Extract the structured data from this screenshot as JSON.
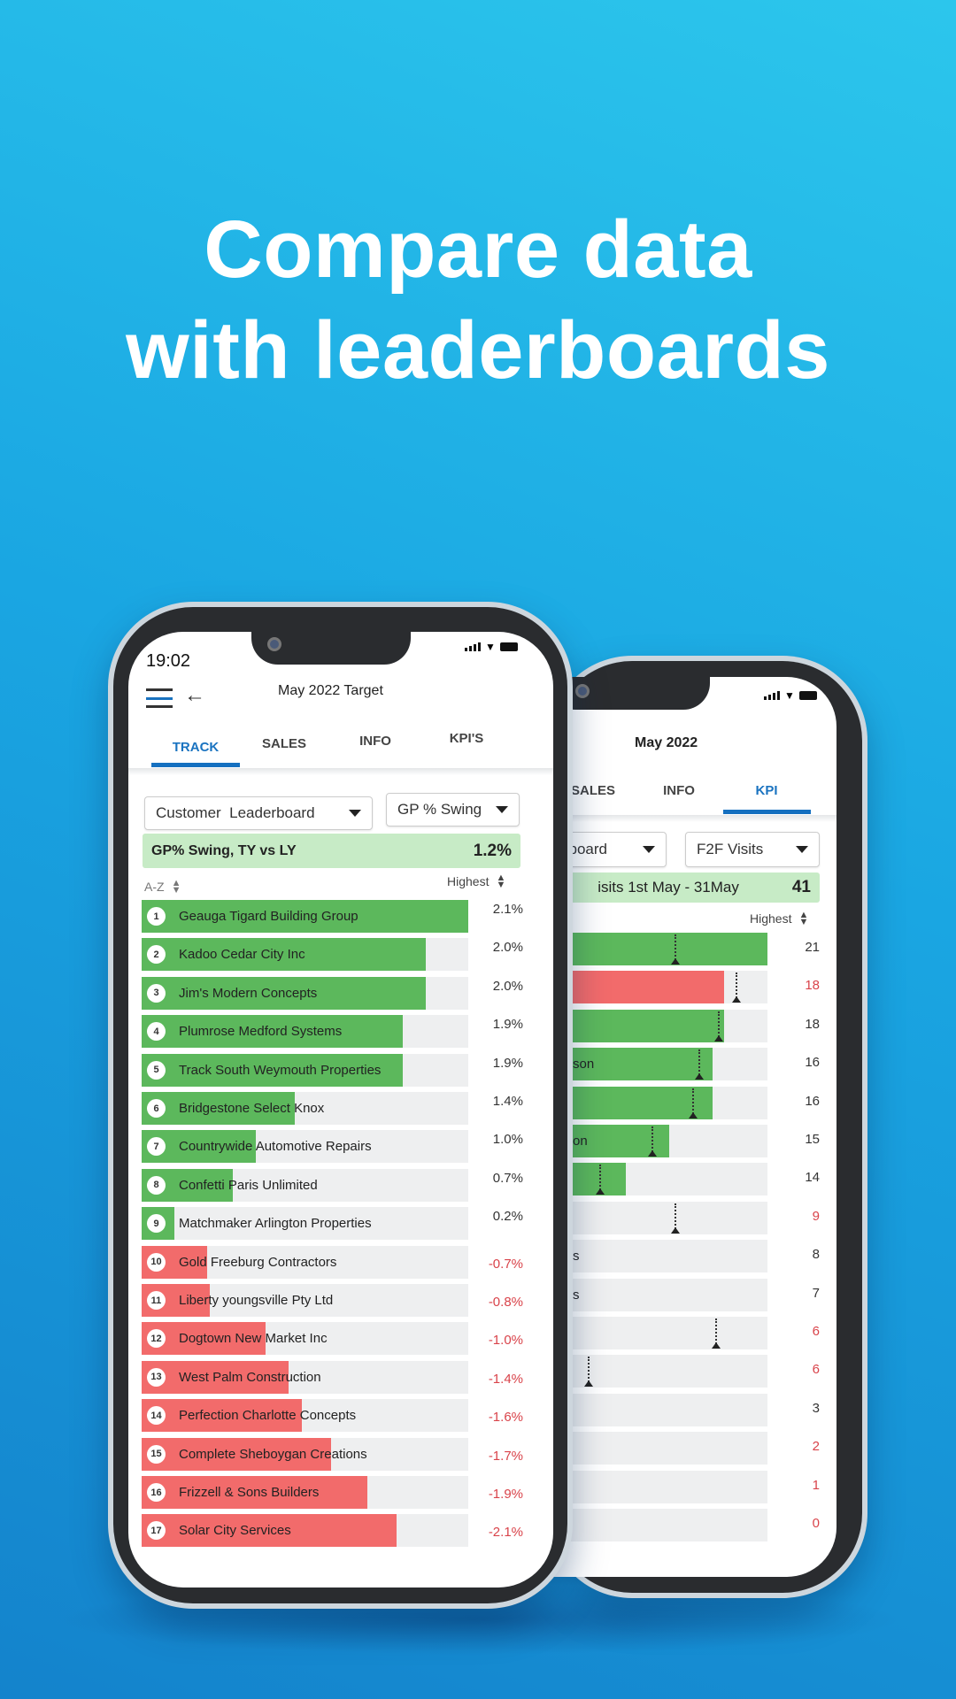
{
  "headline": {
    "line1": "Compare data",
    "line2": "with leaderboards"
  },
  "colors": {
    "positive": "#5cb85c",
    "negative": "#f26b6b",
    "track": "#eeeff0",
    "accent": "#1a73c0",
    "summary_bg": "#c7ebc6",
    "negative_text": "#d9434a"
  },
  "front_phone": {
    "status": {
      "time": "19:02",
      "icons": [
        "signal-icon",
        "wifi-icon",
        "battery-icon"
      ]
    },
    "header": {
      "title": "May 2022 Target",
      "menu_icon": "hamburger-icon",
      "back_icon": "arrow-left-icon"
    },
    "tabs": [
      {
        "label": "TRACK",
        "active": true
      },
      {
        "label": "SALES"
      },
      {
        "label": "INFO"
      },
      {
        "label": "KPI'S"
      }
    ],
    "filters": {
      "leaderboard": "Customer  Leaderboard",
      "metric": "GP % Swing"
    },
    "summary": {
      "label": "GP% Swing, TY vs LY",
      "value": "1.2%"
    },
    "sort": {
      "left": "A-Z",
      "right": "Highest"
    },
    "rows": [
      {
        "rank": "1",
        "name": "Geauga Tigard Building Group",
        "value": "2.1%",
        "fill": 1.0,
        "positive": true
      },
      {
        "rank": "2",
        "name": "Kadoo Cedar City Inc",
        "value": "2.0%",
        "fill": 0.87,
        "positive": true
      },
      {
        "rank": "3",
        "name": "Jim's Modern Concepts",
        "value": "2.0%",
        "fill": 0.87,
        "positive": true
      },
      {
        "rank": "4",
        "name": "Plumrose Medford Systems",
        "value": "1.9%",
        "fill": 0.8,
        "positive": true
      },
      {
        "rank": "5",
        "name": "Track South Weymouth Properties",
        "value": "1.9%",
        "fill": 0.8,
        "positive": true
      },
      {
        "rank": "6",
        "name": "Bridgestone Select Knox",
        "value": "1.4%",
        "fill": 0.47,
        "positive": true
      },
      {
        "rank": "7",
        "name": "Countrywide Automotive Repairs",
        "value": "1.0%",
        "fill": 0.35,
        "positive": true
      },
      {
        "rank": "8",
        "name": "Confetti Paris Unlimited",
        "value": "0.7%",
        "fill": 0.28,
        "positive": true
      },
      {
        "rank": "9",
        "name": "Matchmaker Arlington Properties",
        "value": "0.2%",
        "fill": 0.1,
        "positive": true
      },
      {
        "rank": "10",
        "name": "Gold Freeburg Contractors",
        "value": "-0.7%",
        "fill": 0.2,
        "positive": false
      },
      {
        "rank": "11",
        "name": "Liberty youngsville Pty Ltd",
        "value": "-0.8%",
        "fill": 0.21,
        "positive": false
      },
      {
        "rank": "12",
        "name": "Dogtown New Market Inc",
        "value": "-1.0%",
        "fill": 0.38,
        "positive": false
      },
      {
        "rank": "13",
        "name": "West Palm Construction",
        "value": "-1.4%",
        "fill": 0.45,
        "positive": false
      },
      {
        "rank": "14",
        "name": "Perfection Charlotte Concepts",
        "value": "-1.6%",
        "fill": 0.49,
        "positive": false
      },
      {
        "rank": "15",
        "name": "Complete Sheboygan Creations",
        "value": "-1.7%",
        "fill": 0.58,
        "positive": false
      },
      {
        "rank": "16",
        "name": "Frizzell & Sons Builders",
        "value": "-1.9%",
        "fill": 0.69,
        "positive": false
      },
      {
        "rank": "17",
        "name": "Solar City Services",
        "value": "-2.1%",
        "fill": 0.78,
        "positive": false
      }
    ]
  },
  "back_phone": {
    "status": {
      "icons": [
        "signal-icon",
        "wifi-icon",
        "battery-icon"
      ]
    },
    "header": {
      "title": "May 2022"
    },
    "tabs": [
      {
        "label": "SALES"
      },
      {
        "label": "INFO"
      },
      {
        "label": "KPI",
        "active": true
      }
    ],
    "filters": {
      "leaderboard": "rboard",
      "metric": "F2F Visits"
    },
    "summary": {
      "label": "isits 1st May - 31May",
      "value": "41"
    },
    "sort": {
      "right": "Highest"
    },
    "rows": [
      {
        "label": "",
        "value": "21",
        "fill": 1.0,
        "color": "green",
        "target": 0.68,
        "below": false
      },
      {
        "label": "",
        "value": "18",
        "fill": 0.85,
        "color": "red",
        "target": 0.89,
        "below": true
      },
      {
        "label": "",
        "value": "18",
        "fill": 0.85,
        "color": "green",
        "target": 0.83,
        "below": false
      },
      {
        "label": "son",
        "value": "16",
        "fill": 0.81,
        "color": "green",
        "target": 0.76,
        "below": false
      },
      {
        "label": "",
        "value": "16",
        "fill": 0.81,
        "color": "green",
        "target": 0.74,
        "below": false
      },
      {
        "label": "on",
        "value": "15",
        "fill": 0.66,
        "color": "green",
        "target": 0.6,
        "below": false
      },
      {
        "label": "",
        "value": "14",
        "fill": 0.51,
        "color": "green",
        "target": 0.42,
        "below": false
      },
      {
        "label": "",
        "value": "9",
        "fill": 0,
        "color": "none",
        "target": 0.68,
        "below": true
      },
      {
        "label": "s",
        "value": "8",
        "fill": 0,
        "color": "none",
        "target": null,
        "below": false
      },
      {
        "label": "s",
        "value": "7",
        "fill": 0,
        "color": "none",
        "target": null,
        "below": false
      },
      {
        "label": "",
        "value": "6",
        "fill": 0,
        "color": "none",
        "target": 0.82,
        "below": true
      },
      {
        "label": "",
        "value": "6",
        "fill": 0,
        "color": "none",
        "target": 0.38,
        "below": true
      },
      {
        "label": "",
        "value": "3",
        "fill": 0,
        "color": "none",
        "target": null,
        "below": false
      },
      {
        "label": "",
        "value": "2",
        "fill": 0,
        "color": "none",
        "target": null,
        "below": true
      },
      {
        "label": "",
        "value": "1",
        "fill": 0,
        "color": "none",
        "target": null,
        "below": true
      },
      {
        "label": "",
        "value": "0",
        "fill": 0,
        "color": "none",
        "target": null,
        "below": true
      }
    ]
  }
}
